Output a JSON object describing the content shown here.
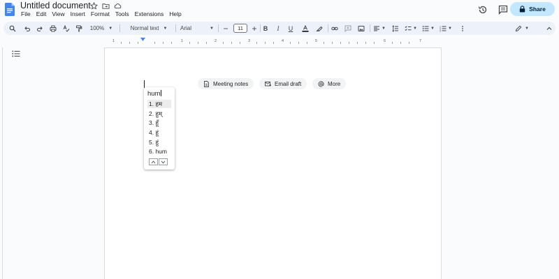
{
  "header": {
    "title": "Untitled document",
    "menu": [
      "File",
      "Edit",
      "View",
      "Insert",
      "Format",
      "Tools",
      "Extensions",
      "Help"
    ],
    "share_label": "Share"
  },
  "toolbar": {
    "zoom": "100%",
    "style": "Normal text",
    "font": "Arial",
    "font_size": "11"
  },
  "ruler": {
    "marks": [
      "1",
      "1",
      "2",
      "3",
      "4",
      "5",
      "6",
      "7"
    ]
  },
  "chips": {
    "meeting_notes": "Meeting notes",
    "email_draft": "Email draft",
    "more": "More"
  },
  "ime": {
    "input": "hum",
    "candidates": [
      "1. हम",
      "2. हुम्",
      "3. हूँ",
      "4. हूं",
      "5. हुं",
      "6. hum"
    ],
    "selected_index": 0
  },
  "colors": {
    "share_bg": "#c2e7ff",
    "toolbar_bg": "#edf2fa",
    "doc_blue": "#4285f4"
  }
}
